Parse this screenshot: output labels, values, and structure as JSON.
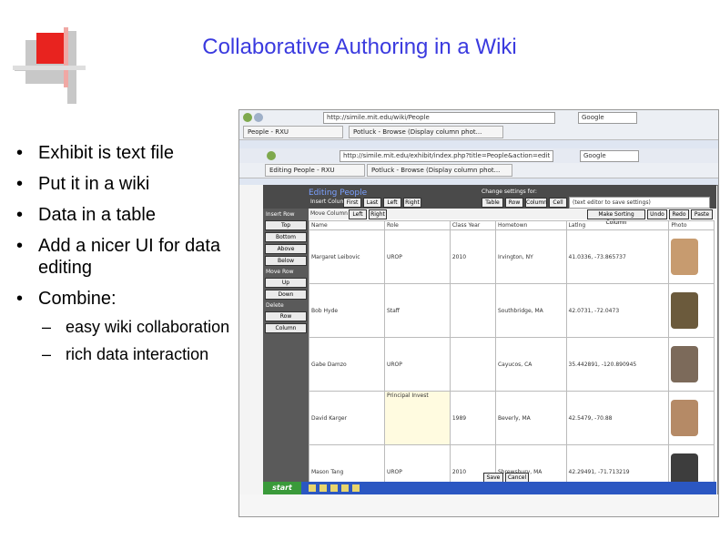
{
  "slide": {
    "title": "Collaborative Authoring in a Wiki",
    "bullets": [
      "Exhibit is text file",
      "Put it in a wiki",
      "Data in a table",
      "Add a nicer UI for data editing",
      "Combine:"
    ],
    "subbullets": [
      "easy wiki collaboration",
      "rich data interaction"
    ],
    "colors": {
      "title": "#3a3adf",
      "logo_red": "#e8231f",
      "logo_gray": "#c8c8c8"
    }
  },
  "screenshot": {
    "url_back": "http://simile.mit.edu/wiki/People",
    "url_front": "http://simile.mit.edu/exhibit/index.php?title=People&action=edit",
    "tab_back_1": "People - RXU",
    "tab_back_2": "Potluck - Browse (Display column phot...",
    "tab_front_1": "Editing People - RXU",
    "tab_front_2": "Potluck - Browse (Display column phot...",
    "search": "Google",
    "edit_title": "Editing People",
    "change_settings": "Change settings for:",
    "settings_buttons": [
      "Table",
      "Row",
      "Column",
      "Cell"
    ],
    "settings_hint": "(text editor to save settings)",
    "insert_column": "Insert Column",
    "move_column": "Move Column",
    "insert_buttons": [
      "First",
      "Last",
      "Left",
      "Right"
    ],
    "move_buttons": [
      "Left",
      "Right"
    ],
    "action_buttons": [
      "Make Sorting Column",
      "Undo",
      "Redo",
      "Paste"
    ],
    "left_panel": {
      "insert_row": "Insert Row",
      "insert_buttons": [
        "Top",
        "Bottom",
        "Above",
        "Below"
      ],
      "move_row": "Move Row",
      "move_buttons": [
        "Up",
        "Down"
      ],
      "delete": "Delete",
      "delete_buttons": [
        "Row",
        "Column"
      ]
    },
    "columns": [
      "Name",
      "Role",
      "Class Year",
      "Hometown",
      "Latlng",
      "Photo"
    ],
    "rows": [
      [
        "Margaret Leibovic",
        "UROP",
        "2010",
        "Irvington, NY",
        "41.0336, -73.865737"
      ],
      [
        "Bob Hyde",
        "Staff",
        "",
        "Southbridge, MA",
        "42.0731, -72.0473"
      ],
      [
        "Gabe Damzo",
        "UROP",
        "",
        "Cayucos, CA",
        "35.442891, -120.890945"
      ],
      [
        "David Karger",
        "Principal Invest",
        "1989",
        "Beverly, MA",
        "42.5479, -70.88"
      ],
      [
        "Mason Tang",
        "UROP",
        "2010",
        "Shrewsbury, MA",
        "42.29491, -71.713219"
      ]
    ],
    "save_label": "Save",
    "cancel_label": "Cancel",
    "taskbar_start": "start"
  }
}
